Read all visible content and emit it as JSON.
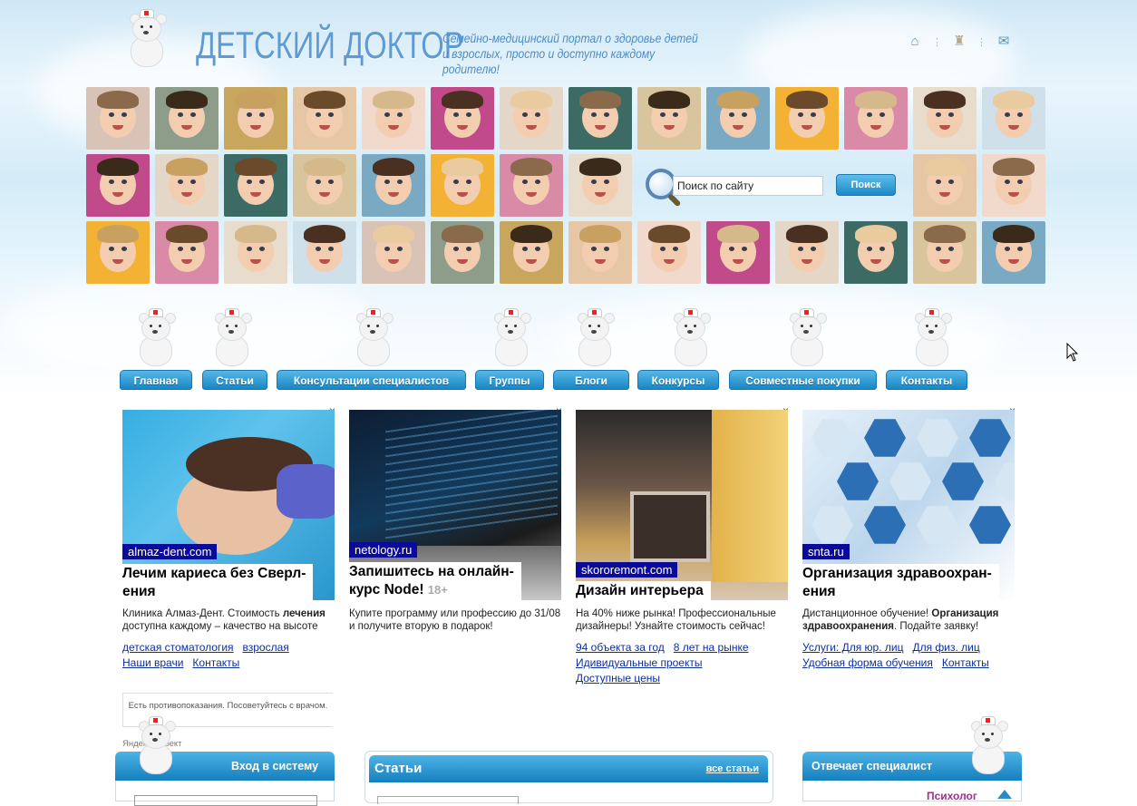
{
  "header": {
    "logo_title": "ДЕТСКИЙ ДОКТОР",
    "logo_subtitle_line1": "Семейно-медицинский портал о здоровье детей",
    "logo_subtitle_line2": "и взрослых, просто и доступно каждому родителю!",
    "icons": [
      "home-icon",
      "sitemap-icon",
      "mail-icon"
    ]
  },
  "search": {
    "placeholder": "Поиск по сайту",
    "button_label": "Поиск"
  },
  "nav": {
    "items": [
      {
        "label": "Главная"
      },
      {
        "label": "Статьи"
      },
      {
        "label": "Консультации специалистов"
      },
      {
        "label": "Группы"
      },
      {
        "label": "Блоги"
      },
      {
        "label": "Конкурсы"
      },
      {
        "label": "Совместные покупки"
      },
      {
        "label": "Контакты"
      }
    ]
  },
  "ads": [
    {
      "domain": "almaz-dent.com",
      "title": "Лечим кариеса без Сверл-ения",
      "title_line1": "Лечим кариеса без Сверл-",
      "title_line2": "ения",
      "desc_a": "Клиника Алмаз-Дент. Стоимость ",
      "desc_bold": "лечения",
      "desc_b": " доступна каждому – качество на высоте",
      "links": [
        "детская стоматология",
        "взрослая",
        "Наши врачи",
        "Контакты"
      ]
    },
    {
      "domain": "netology.ru",
      "title_line1": "Запишитесь на онлайн-",
      "title_line2": "курс Node!",
      "age": "18+",
      "desc_a": "Купите программу или профессию до 31/08 и получите вторую в подарок!",
      "links": []
    },
    {
      "domain": "skororemont.com",
      "title_line1": "Дизайн интерьера",
      "desc_a": "На 40% ниже рынка! Профессиональные дизайнеры! Узнайте стоимость сейчас!",
      "links": [
        "94 объекта за год",
        "8 лет на рынке",
        "Идивидуальные проекты",
        "Доступные цены"
      ]
    },
    {
      "domain": "snta.ru",
      "title_line1": "Организация здравоохран-",
      "title_line2": "ения",
      "desc_a": "Дистанционное обучение! ",
      "desc_bold": "Организация здравоохранения",
      "desc_b": ". Подайте заявку!",
      "links": [
        "Услуги: Для юр. лиц",
        "Для физ. лиц",
        "Удобная форма обучения",
        "Контакты"
      ]
    }
  ],
  "ad_close": "×",
  "ad_warning": "Есть противопоказания. Посоветуйтесь с врачом.",
  "yandex_direct": "Яндекс.Директ",
  "panels": {
    "login_title": "Вход в систему",
    "articles_title": "Статьи",
    "articles_all": "все статьи",
    "expert_title": "Отвечает специалист",
    "expert_role": "Психолог"
  },
  "colors": {
    "accent": "#1a86c4",
    "logo": "#5e9bd2",
    "ad_domain_bg": "#0a0a9c",
    "link": "#0c2e9e"
  }
}
